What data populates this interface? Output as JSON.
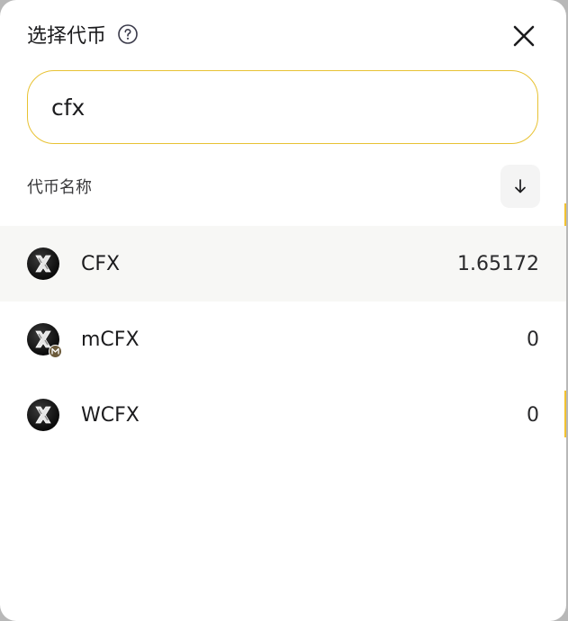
{
  "dialog": {
    "title": "选择代币",
    "help_icon": "question-circle-icon",
    "close_icon": "close-x-icon"
  },
  "search": {
    "value": "cfx",
    "placeholder": ""
  },
  "list_header": {
    "label": "代币名称",
    "sort_icon": "arrow-down-icon"
  },
  "tokens": [
    {
      "symbol": "CFX",
      "balance": "1.65172",
      "icon": "conflux-logo-icon",
      "badge": "",
      "selected": true
    },
    {
      "symbol": "mCFX",
      "balance": "0",
      "icon": "conflux-logo-icon",
      "badge": "m-badge-icon",
      "selected": false
    },
    {
      "symbol": "WCFX",
      "balance": "0",
      "icon": "conflux-logo-icon",
      "badge": "",
      "selected": false
    }
  ],
  "colors": {
    "accent": "#e8c233",
    "selected_row": "#f7f7f5",
    "text": "#1c1c1e"
  }
}
